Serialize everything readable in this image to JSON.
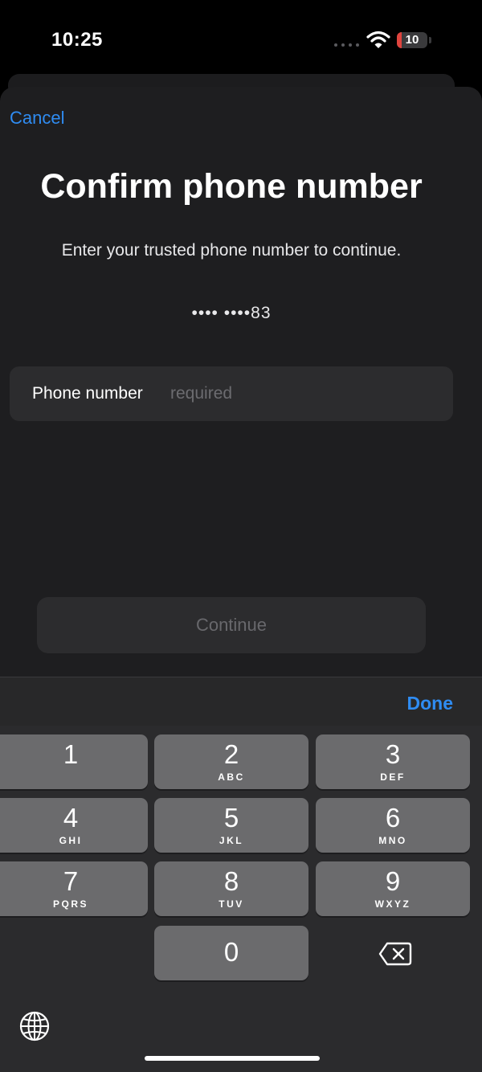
{
  "status_bar": {
    "time": "10:25",
    "battery_level": "10"
  },
  "sheet": {
    "cancel_label": "Cancel",
    "title": "Confirm phone number",
    "subtitle": "Enter your trusted phone number to continue.",
    "masked_number": "•••• ••••83",
    "field": {
      "label": "Phone number",
      "placeholder": "required",
      "value": ""
    },
    "continue_label": "Continue"
  },
  "keyboard": {
    "done_label": "Done",
    "keys": [
      {
        "digit": "1",
        "letters": ""
      },
      {
        "digit": "2",
        "letters": "ABC"
      },
      {
        "digit": "3",
        "letters": "DEF"
      },
      {
        "digit": "4",
        "letters": "GHI"
      },
      {
        "digit": "5",
        "letters": "JKL"
      },
      {
        "digit": "6",
        "letters": "MNO"
      },
      {
        "digit": "7",
        "letters": "PQRS"
      },
      {
        "digit": "8",
        "letters": "TUV"
      },
      {
        "digit": "9",
        "letters": "WXYZ"
      },
      {
        "digit": "0",
        "letters": ""
      }
    ],
    "icons": [
      "backspace-icon",
      "globe-icon"
    ]
  },
  "colors": {
    "accent": "#2f8cf2",
    "sheet_bg": "#1e1e20",
    "key_bg": "#6b6b6d",
    "battery_low": "#e0443e"
  }
}
